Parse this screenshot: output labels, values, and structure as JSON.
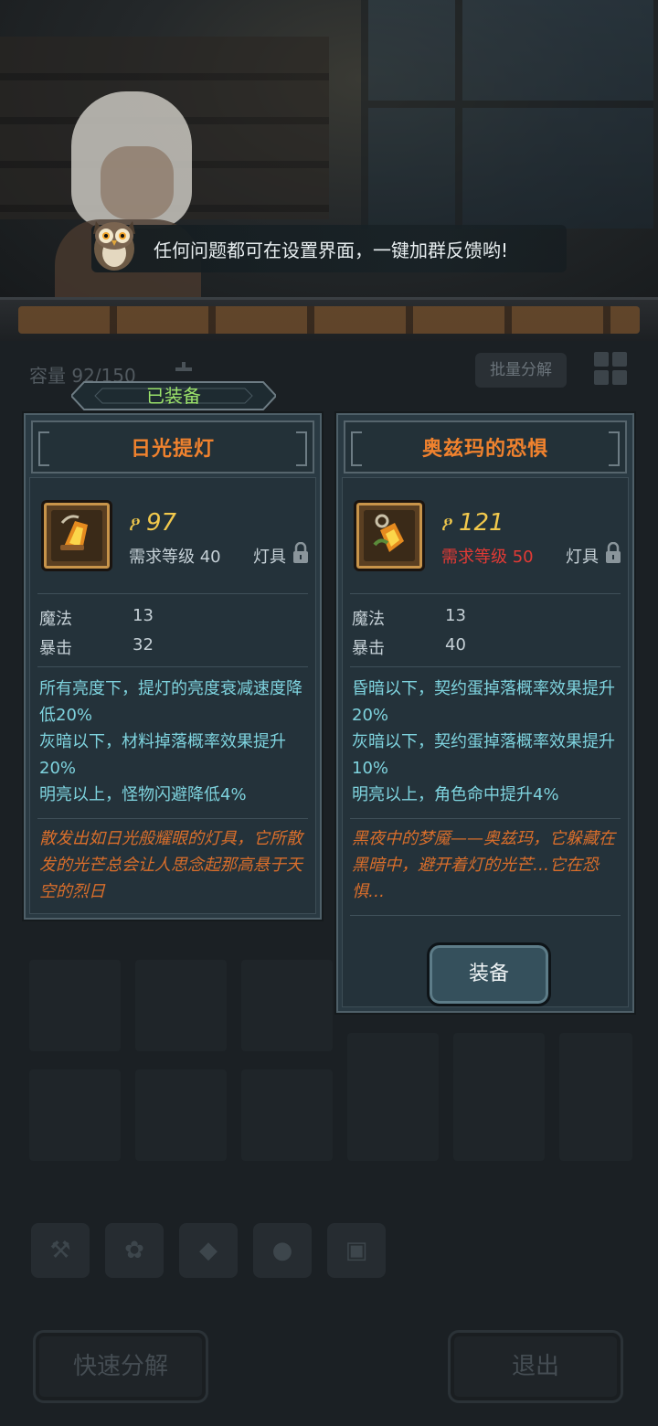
{
  "tip": {
    "text": "任何问题都可在设置界面，一键加群反馈哟!"
  },
  "inventory": {
    "capacity_label": "容量 92/150",
    "batch_button": "批量分解",
    "filters": [
      {
        "icon": "weapon-icon",
        "glyph": "⚒"
      },
      {
        "icon": "paw-icon",
        "glyph": "✿"
      },
      {
        "icon": "gem-icon",
        "glyph": "◆"
      },
      {
        "icon": "fruit-icon",
        "glyph": "●"
      },
      {
        "icon": "chest-icon",
        "glyph": "▣"
      }
    ],
    "quick_disassemble": "快速分解",
    "exit": "退出"
  },
  "equipped_tag": "已装备",
  "left_item": {
    "name": "日光提灯",
    "power": "97",
    "requirement": "需求等级 40",
    "requirement_met": true,
    "type": "灯具",
    "stats": [
      {
        "name": "魔法",
        "value": "13"
      },
      {
        "name": "暴击",
        "value": "32"
      }
    ],
    "effects": [
      "所有亮度下，提灯的亮度衰减速度降低20%",
      "灰暗以下，材料掉落概率效果提升20%",
      "明亮以上，怪物闪避降低4%"
    ],
    "lore": "散发出如日光般耀眼的灯具，它所散发的光芒总会让人思念起那高悬于天空的烈日"
  },
  "right_item": {
    "name": "奥兹玛的恐惧",
    "power": "121",
    "requirement": "需求等级 50",
    "requirement_met": false,
    "type": "灯具",
    "stats": [
      {
        "name": "魔法",
        "value": "13"
      },
      {
        "name": "暴击",
        "value": "40"
      }
    ],
    "effects": [
      "昏暗以下，契约蛋掉落概率效果提升20%",
      "灰暗以下，契约蛋掉落概率效果提升10%",
      "明亮以上，角色命中提升4%"
    ],
    "lore": "黑夜中的梦魇——奥兹玛，它躲藏在黑暗中，避开着灯的光芒…它在恐惧…",
    "equip_button": "装备"
  },
  "colors": {
    "title_orange": "#f0822e",
    "power_gold": "#f2c94c",
    "effect_cyan": "#7ed3de",
    "lore_orange": "#d96e2b",
    "requirement_red": "#e23a35",
    "equipped_green": "#9be26a"
  }
}
